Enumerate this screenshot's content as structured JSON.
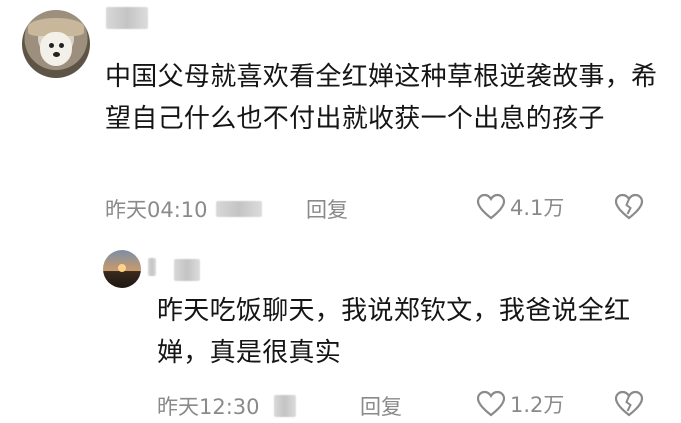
{
  "comment": {
    "text": "中国父母就喜欢看全红婵这种草根逆袭故事，希望自己什么也不付出就收获一个出息的孩子",
    "timestamp": "昨天04:10",
    "reply_label": "回复",
    "like_count": "4.1万"
  },
  "reply": {
    "text": "昨天吃饭聊天，我说郑钦文，我爸说全红婵，真是很真实",
    "timestamp": "昨天12:30",
    "reply_label": "回复",
    "like_count": "1.2万"
  },
  "colors": {
    "meta_gray": "#8a8a8a",
    "text": "#151515"
  },
  "icons": {
    "like": "heart-outline-icon",
    "dislike": "broken-heart-icon"
  }
}
